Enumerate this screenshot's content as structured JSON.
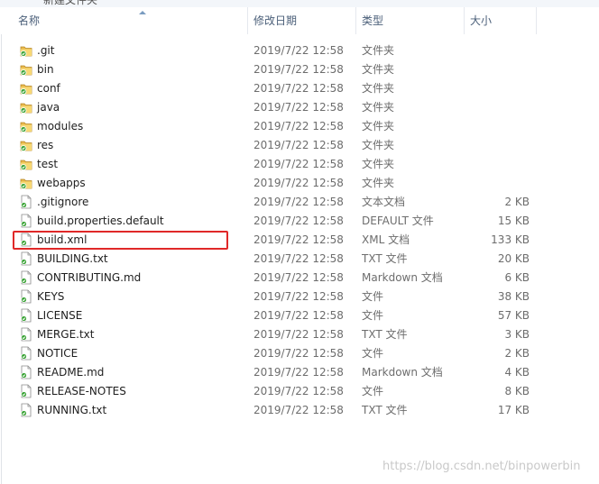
{
  "topbar": {
    "title": "新建文件夹"
  },
  "columns": {
    "name": "名称",
    "date": "修改日期",
    "type": "类型",
    "size": "大小"
  },
  "files": [
    {
      "name": ".git",
      "date": "2019/7/22 12:58",
      "type": "文件夹",
      "size": "",
      "icon": "folder-icon"
    },
    {
      "name": "bin",
      "date": "2019/7/22 12:58",
      "type": "文件夹",
      "size": "",
      "icon": "folder-icon"
    },
    {
      "name": "conf",
      "date": "2019/7/22 12:58",
      "type": "文件夹",
      "size": "",
      "icon": "folder-icon"
    },
    {
      "name": "java",
      "date": "2019/7/22 12:58",
      "type": "文件夹",
      "size": "",
      "icon": "folder-icon"
    },
    {
      "name": "modules",
      "date": "2019/7/22 12:58",
      "type": "文件夹",
      "size": "",
      "icon": "folder-icon"
    },
    {
      "name": "res",
      "date": "2019/7/22 12:58",
      "type": "文件夹",
      "size": "",
      "icon": "folder-icon"
    },
    {
      "name": "test",
      "date": "2019/7/22 12:58",
      "type": "文件夹",
      "size": "",
      "icon": "folder-icon"
    },
    {
      "name": "webapps",
      "date": "2019/7/22 12:58",
      "type": "文件夹",
      "size": "",
      "icon": "folder-icon"
    },
    {
      "name": ".gitignore",
      "date": "2019/7/22 12:58",
      "type": "文本文档",
      "size": "2 KB",
      "icon": "file-icon"
    },
    {
      "name": "build.properties.default",
      "date": "2019/7/22 12:58",
      "type": "DEFAULT 文件",
      "size": "15 KB",
      "icon": "file-icon"
    },
    {
      "name": "build.xml",
      "date": "2019/7/22 12:58",
      "type": "XML 文档",
      "size": "133 KB",
      "icon": "file-icon"
    },
    {
      "name": "BUILDING.txt",
      "date": "2019/7/22 12:58",
      "type": "TXT 文件",
      "size": "20 KB",
      "icon": "file-icon"
    },
    {
      "name": "CONTRIBUTING.md",
      "date": "2019/7/22 12:58",
      "type": "Markdown 文档",
      "size": "6 KB",
      "icon": "file-icon"
    },
    {
      "name": "KEYS",
      "date": "2019/7/22 12:58",
      "type": "文件",
      "size": "38 KB",
      "icon": "file-icon"
    },
    {
      "name": "LICENSE",
      "date": "2019/7/22 12:58",
      "type": "文件",
      "size": "57 KB",
      "icon": "file-icon"
    },
    {
      "name": "MERGE.txt",
      "date": "2019/7/22 12:58",
      "type": "TXT 文件",
      "size": "3 KB",
      "icon": "file-icon"
    },
    {
      "name": "NOTICE",
      "date": "2019/7/22 12:58",
      "type": "文件",
      "size": "2 KB",
      "icon": "file-icon"
    },
    {
      "name": "README.md",
      "date": "2019/7/22 12:58",
      "type": "Markdown 文档",
      "size": "4 KB",
      "icon": "file-icon"
    },
    {
      "name": "RELEASE-NOTES",
      "date": "2019/7/22 12:58",
      "type": "文件",
      "size": "8 KB",
      "icon": "file-icon"
    },
    {
      "name": "RUNNING.txt",
      "date": "2019/7/22 12:58",
      "type": "TXT 文件",
      "size": "17 KB",
      "icon": "file-icon"
    }
  ],
  "highlighted_file": "build.xml",
  "colors": {
    "highlight_border": "#e02828",
    "header_text": "#4c607a",
    "folder_yellow": "#f2c94c",
    "status_green": "#3aa335"
  },
  "watermark": "https://blog.csdn.net/binpowerbin"
}
